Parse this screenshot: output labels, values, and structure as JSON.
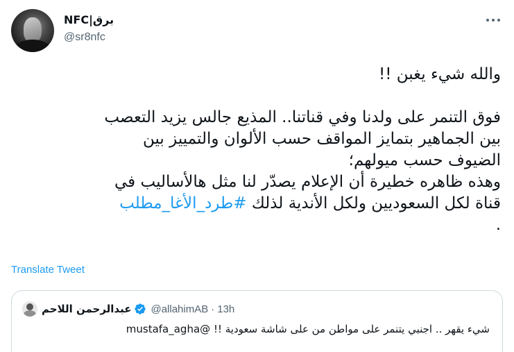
{
  "author": {
    "display_name": "NFC|برق",
    "handle": "@sr8nfc"
  },
  "tweet": {
    "lines": [
      "والله شيء يغبن !!",
      "",
      "فوق التنمر على ولدنا وفي قناتنا.. المذيع جالس يزيد التعصب",
      "بين الجماهير بتمايز المواقف حسب الألوان والتمييز بين",
      "الضيوف حسب ميولهم؛",
      "وهذه ظاهره خطيرة أن الإعلام يصدّر لنا مثل هالأساليب في"
    ],
    "last_line_text": "قناة لكل السعوديين ولكل الأندية لذلك ",
    "hashtag": "#طرد_الأغا_مطلب",
    "trailing": "."
  },
  "translate_label": "Translate Tweet",
  "quoted": {
    "name": "عبدالرحمن اللاحم",
    "handle": "@allahimAB",
    "separator": "·",
    "time": "13h",
    "text": "شيء يقهر .. اجنبي يتنمر على مواطن من على شاشة سعودية !! @mustafa_agha"
  },
  "colors": {
    "link": "#1d9bf0",
    "secondary_text": "#536471",
    "border": "#cfd9de",
    "verified": "#1d9bf0"
  },
  "icons": {
    "more": "more-horizontal-icon",
    "verified": "verified-badge-icon"
  }
}
